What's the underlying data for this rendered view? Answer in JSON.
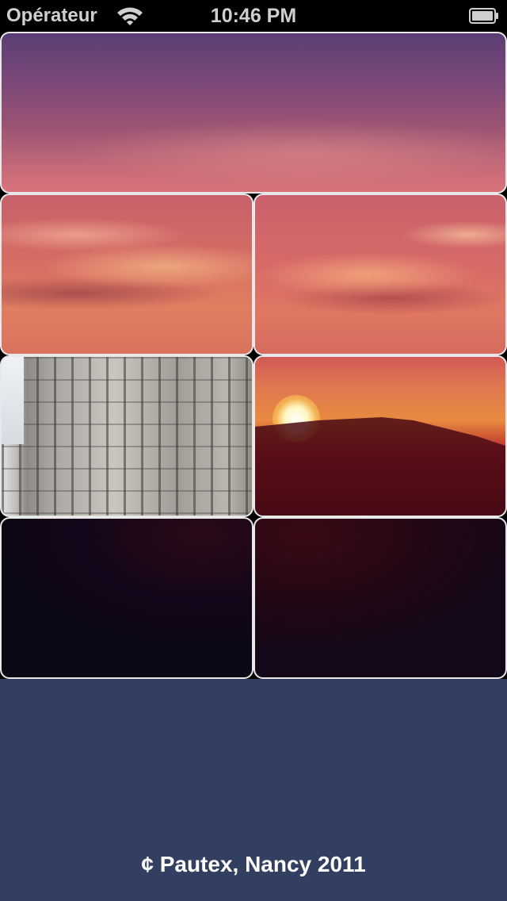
{
  "status_bar": {
    "carrier": "Opérateur",
    "time": "10:46 PM",
    "wifi_icon": "wifi-icon",
    "battery_icon": "battery-icon"
  },
  "puzzle": {
    "tiles": [
      {
        "name": "tile-sky-wide",
        "content": "sunset sky"
      },
      {
        "name": "tile-sky-left",
        "content": "sunset clouds"
      },
      {
        "name": "tile-sky-right",
        "content": "sunset clouds"
      },
      {
        "name": "tile-building",
        "content": "cathedral tower"
      },
      {
        "name": "tile-sun",
        "content": "setting sun over hill"
      },
      {
        "name": "tile-dark-left",
        "content": "dark foreground"
      },
      {
        "name": "tile-dark-right",
        "content": "dark foreground"
      }
    ]
  },
  "footer": {
    "credit": "¢ Pautex, Nancy 2011"
  },
  "colors": {
    "background": "#323f60",
    "status_bar": "#000000",
    "tile_border": "#e8e8e8"
  }
}
